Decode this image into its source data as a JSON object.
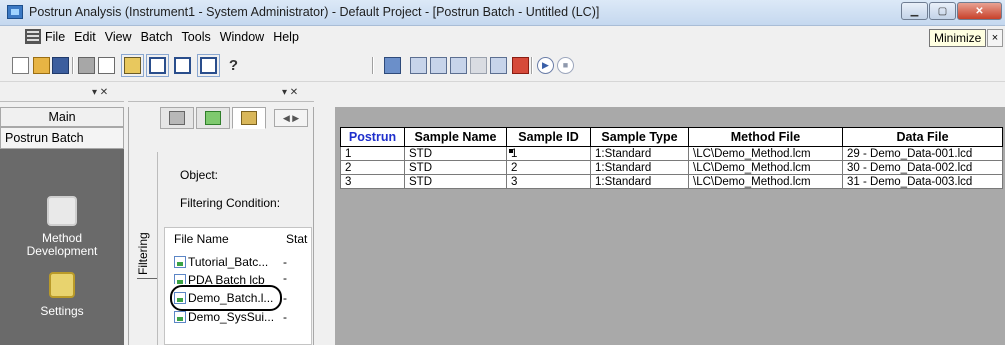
{
  "window": {
    "title": "Postrun Analysis (Instrument1 - System Administrator) - Default Project - [Postrun Batch - Untitled (LC)]",
    "minimize_tooltip": "Minimize"
  },
  "menu": {
    "items": [
      {
        "label": "File"
      },
      {
        "label": "Edit"
      },
      {
        "label": "View"
      },
      {
        "label": "Batch"
      },
      {
        "label": "Tools"
      },
      {
        "label": "Window"
      },
      {
        "label": "Help"
      }
    ]
  },
  "toolbar": {
    "help_label": "?"
  },
  "nav": {
    "header": "Main",
    "selected": "Postrun Batch",
    "items": [
      {
        "label": "Method\nDevelopment",
        "icon": "method-development-icon"
      },
      {
        "label": "Settings",
        "icon": "settings-icon"
      }
    ]
  },
  "middle": {
    "filtering_tab": "Filtering",
    "object_label": "Object:",
    "filtering_condition_label": "Filtering Condition:",
    "file_list": {
      "headers": [
        "File Name",
        "Stat"
      ],
      "rows": [
        {
          "name": "Tutorial_Batc...",
          "status": "-"
        },
        {
          "name": "PDA Batch lcb",
          "status": "-"
        },
        {
          "name": "Demo_Batch.l...",
          "status": "-"
        },
        {
          "name": "Demo_SysSui...",
          "status": "-"
        }
      ]
    }
  },
  "batch_table": {
    "headers": [
      "Postrun",
      "Sample Name",
      "Sample ID",
      "Sample Type",
      "Method File",
      "Data File"
    ],
    "rows": [
      [
        "1",
        "STD",
        "1",
        "1:Standard",
        "\\LC\\Demo_Method.lcm",
        "29 - Demo_Data-001.lcd"
      ],
      [
        "2",
        "STD",
        "2",
        "1:Standard",
        "\\LC\\Demo_Method.lcm",
        "30 - Demo_Data-002.lcd"
      ],
      [
        "3",
        "STD",
        "3",
        "1:Standard",
        "\\LC\\Demo_Method.lcm",
        "31 - Demo_Data-003.lcd"
      ]
    ]
  },
  "colors": {
    "accent_header_text": "#1f2fcc",
    "nav_background": "#6a6a6a",
    "table_background": "#a9a9a9"
  }
}
